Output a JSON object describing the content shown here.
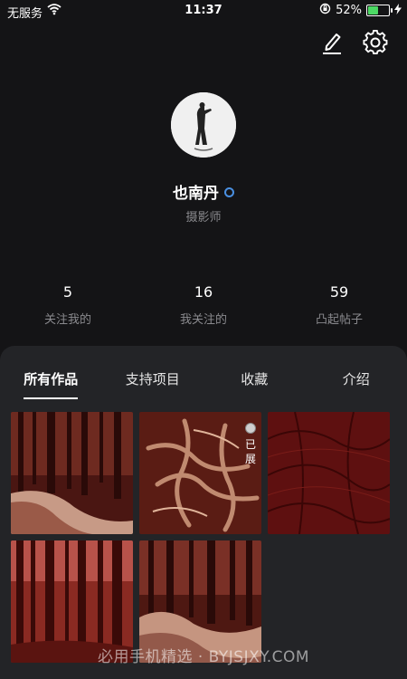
{
  "status_bar": {
    "carrier": "无服务",
    "time": "11:37",
    "battery_percent_label": "52%",
    "battery_level": 0.52,
    "icons": [
      "wifi-icon",
      "orientation-lock-icon",
      "battery-icon",
      "charging-icon"
    ]
  },
  "header": {
    "actions": [
      {
        "name": "edit",
        "icon": "pen-edit-icon"
      },
      {
        "name": "settings",
        "icon": "gear-icon"
      }
    ]
  },
  "profile": {
    "name": "也南丹",
    "role": "摄影师",
    "verified_icon": "verified-ring-icon",
    "verified_color": "#4a90e2"
  },
  "stats": [
    {
      "value": "5",
      "label": "关注我的"
    },
    {
      "value": "16",
      "label": "我关注的"
    },
    {
      "value": "59",
      "label": "凸起帖子"
    }
  ],
  "tabs": [
    {
      "label": "所有作品",
      "active": true
    },
    {
      "label": "支持项目",
      "active": false
    },
    {
      "label": "收藏",
      "active": false
    },
    {
      "label": "介绍",
      "active": false
    }
  ],
  "works": [
    {
      "subject": "forest path with ferns",
      "badge": ""
    },
    {
      "subject": "tree roots",
      "badge": "已展"
    },
    {
      "subject": "tree bark",
      "badge": ""
    },
    {
      "subject": "forest trees",
      "badge": ""
    },
    {
      "subject": "forest ferns",
      "badge": ""
    }
  ],
  "badge_chars": [
    "已",
    "展"
  ],
  "watermark": "必用手机精选 · BYJSJXY.COM",
  "colors": {
    "background": "#141416",
    "panel": "#232427",
    "muted_text": "#8a8a8e",
    "photo_tint": "#8b2a22"
  }
}
